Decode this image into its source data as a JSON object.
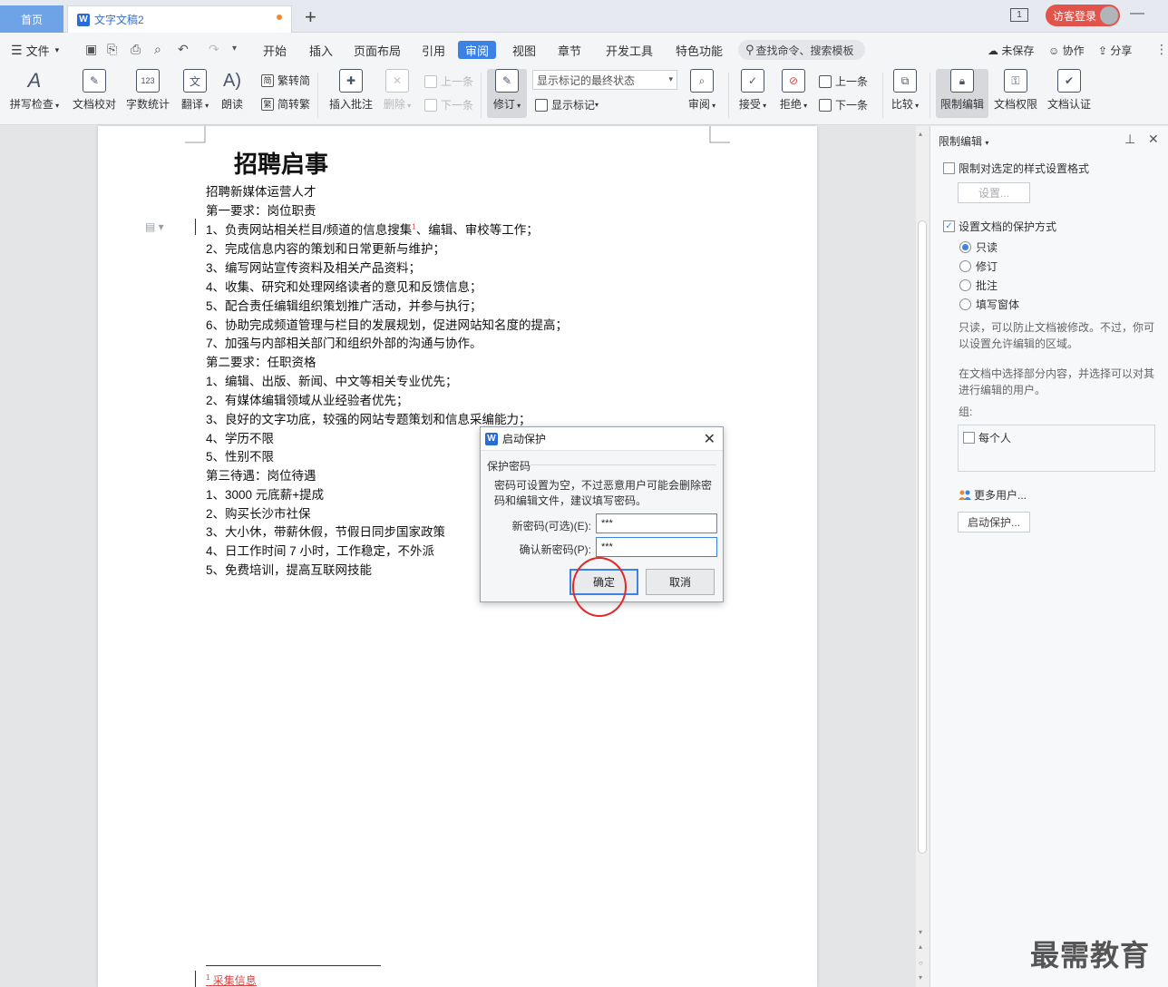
{
  "titlebar": {
    "home_tab": "首页",
    "doc_tab": "文字文稿2",
    "new_tab": "+",
    "login": "访客登录",
    "page_indicator": "1",
    "minimize": "—",
    "maximize": "▢",
    "close": "✕"
  },
  "menubar": {
    "file": "文件",
    "items": [
      "开始",
      "插入",
      "页面布局",
      "引用",
      "审阅",
      "视图",
      "章节",
      "开发工具",
      "特色功能"
    ],
    "search": "查找命令、搜索模板",
    "unsaved": "未保存",
    "collab": "协作",
    "share": "分享"
  },
  "ribbon": {
    "spell_check": "拼写检查",
    "doc_proof": "文档校对",
    "word_count": "字数统计",
    "translate": "翻译",
    "read_aloud": "朗读",
    "trad_simp": "繁转简",
    "simp_trad": "简转繁",
    "insert_comment": "插入批注",
    "delete": "删除",
    "prev_comment": "上一条",
    "next_comment": "下一条",
    "track": "修订",
    "markup_select": "显示标记的最终状态",
    "show_markup": "显示标记",
    "review": "审阅",
    "accept": "接受",
    "reject": "拒绝",
    "prev_change": "上一条",
    "next_change": "下一条",
    "compare": "比较",
    "restrict_edit": "限制编辑",
    "doc_permission": "文档权限",
    "doc_cert": "文档认证"
  },
  "document": {
    "title": "招聘启事",
    "lines": [
      "招聘新媒体运营人才",
      "第一要求：岗位职责",
      "1、负责网站相关栏目/频道的信息搜集",
      "2、完成信息内容的策划和日常更新与维护；",
      "3、编写网站宣传资料及相关产品资料；",
      "4、收集、研究和处理网络读者的意见和反馈信息；",
      "5、配合责任编辑组织策划推广活动，并参与执行；",
      "6、协助完成频道管理与栏目的发展规划，促进网站知名度的提高；",
      "7、加强与内部相关部门和组织外部的沟通与协作。",
      "第二要求：任职资格",
      "1、编辑、出版、新闻、中文等相关专业优先；",
      "2、有媒体编辑领域从业经验者优先；",
      "3、良好的文字功底，较强的网站专题策划和信息采编能力；",
      "4、学历不限",
      "5、性别不限",
      "第三待遇：岗位待遇",
      "1、3000 元底薪+提成",
      "2、购买长沙市社保",
      "3、大小休，带薪休假，节假日同步国家政策",
      "4、日工作时间 7 小时，工作稳定，不外派",
      "5、免费培训，提高互联网技能"
    ],
    "line2_tail": "、编辑、审校等工作；",
    "footnote_ref": "1",
    "footnote_num": "1",
    "footnote_text": "采集信息"
  },
  "panel": {
    "title": "限制编辑",
    "opt1": "限制对选定的样式设置格式",
    "settings_btn": "设置...",
    "opt2": "设置文档的保护方式",
    "radios": [
      "只读",
      "修订",
      "批注",
      "填写窗体"
    ],
    "desc1": "只读，可以防止文档被修改。不过，你可以设置允许编辑的区域。",
    "desc2": "在文档中选择部分内容，并选择可以对其进行编辑的用户。",
    "group_label": "组:",
    "everyone": "每个人",
    "more_users": "更多用户...",
    "start_btn": "启动保护..."
  },
  "dialog": {
    "title": "启动保护",
    "group": "保护密码",
    "message": "密码可设置为空，不过恶意用户可能会删除密码和编辑文件，建议填写密码。",
    "new_pwd_label": "新密码(可选)(E):",
    "new_pwd_value": "***",
    "confirm_pwd_label": "确认新密码(P):",
    "confirm_pwd_value": "***",
    "ok": "确定",
    "cancel": "取消"
  },
  "watermark": "最需教育",
  "colors": {
    "accent": "#3c82e4",
    "home_tab": "#6ea3e8",
    "login": "#e0544c",
    "annotation": "#e02a2a"
  }
}
